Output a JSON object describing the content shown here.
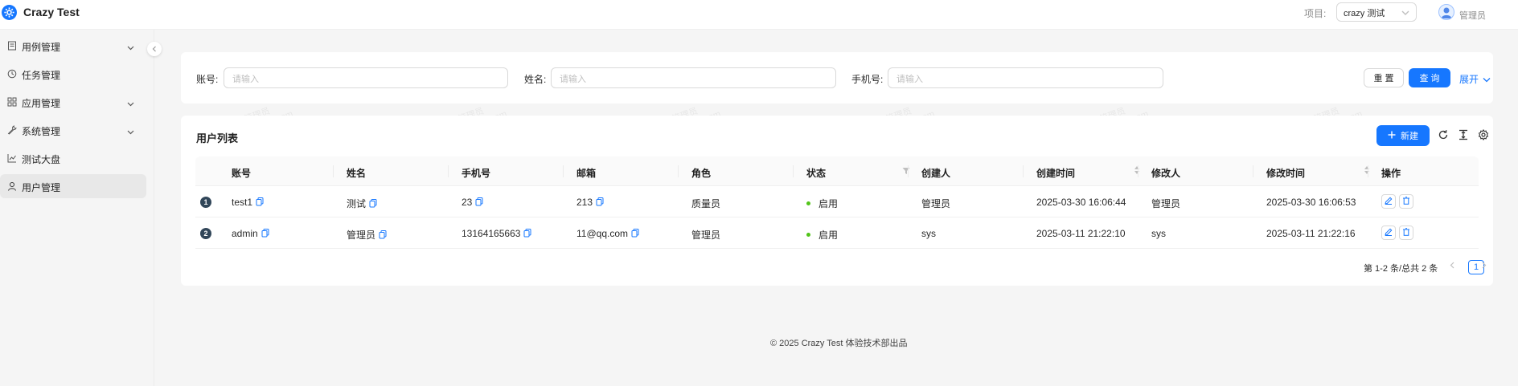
{
  "header": {
    "app_title": "Crazy Test",
    "project_label": "项目:",
    "project_value": "crazy 测试",
    "user_name": "管理员"
  },
  "sidebar": {
    "items": [
      {
        "label": "用例管理",
        "icon": "file-icon",
        "has_submenu": true
      },
      {
        "label": "任务管理",
        "icon": "clock-icon",
        "has_submenu": false
      },
      {
        "label": "应用管理",
        "icon": "grid-icon",
        "has_submenu": true
      },
      {
        "label": "系统管理",
        "icon": "tool-icon",
        "has_submenu": true
      },
      {
        "label": "测试大盘",
        "icon": "chart-icon",
        "has_submenu": false
      },
      {
        "label": "用户管理",
        "icon": "user-icon",
        "has_submenu": false,
        "active": true
      }
    ]
  },
  "search": {
    "account_label": "账号:",
    "account_placeholder": "请输入",
    "name_label": "姓名:",
    "name_placeholder": "请输入",
    "phone_label": "手机号:",
    "phone_placeholder": "请输入",
    "reset_label": "重 置",
    "query_label": "查 询",
    "expand_label": "展开"
  },
  "table": {
    "title": "用户列表",
    "new_label": "新建",
    "columns": [
      "账号",
      "姓名",
      "手机号",
      "邮箱",
      "角色",
      "状态",
      "创建人",
      "创建时间",
      "修改人",
      "修改时间",
      "操作"
    ],
    "rows": [
      {
        "index": "1",
        "account": "test1",
        "name": "测试",
        "phone": "23",
        "email": "213",
        "role": "质量员",
        "status": "启用",
        "creator": "管理员",
        "created_at": "2025-03-30 16:06:44",
        "modifier": "管理员",
        "modified_at": "2025-03-30 16:06:53"
      },
      {
        "index": "2",
        "account": "admin",
        "name": "管理员",
        "phone": "13164165663",
        "email": "11@qq.com",
        "role": "管理员",
        "status": "启用",
        "creator": "sys",
        "created_at": "2025-03-11 21:22:10",
        "modifier": "sys",
        "modified_at": "2025-03-11 21:22:16"
      }
    ]
  },
  "pagination": {
    "total_text": "第 1-2 条/总共 2 条",
    "current_page": "1"
  },
  "footer": {
    "text": "© 2025 Crazy Test 体验技术部出品"
  },
  "watermark": {
    "line1": "管理员",
    "line2": "11@qq.com"
  },
  "colors": {
    "primary": "#1677ff",
    "status_enabled": "#52c41a",
    "index_badge": "#314659"
  }
}
